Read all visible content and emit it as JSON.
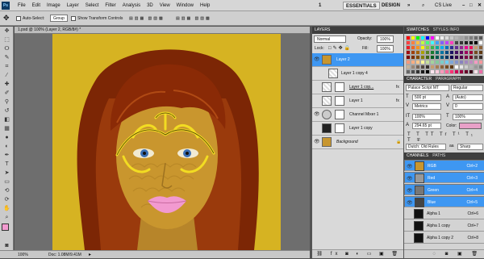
{
  "app": {
    "logo": "Ps",
    "ws_number": "1",
    "ws_essentials": "ESSENTIALS",
    "ws_design": "DESIGN",
    "ws_more": "»",
    "cs_live": "CS Live"
  },
  "menu": [
    "File",
    "Edit",
    "Image",
    "Layer",
    "Select",
    "Filter",
    "Analysis",
    "3D",
    "View",
    "Window",
    "Help"
  ],
  "options": {
    "auto_select": "Auto-Select:",
    "group": "Group",
    "show_transform": "Show Transform Controls"
  },
  "document": {
    "tab": "1.psd @ 100% (Layer 2, RGB/8#) *",
    "zoom": "100%",
    "doc_size": "Doc: 1.08M/9.41M"
  },
  "layers": {
    "tabs": [
      "LAYERS"
    ],
    "blend_mode": "Normal",
    "opacity_label": "Opacity:",
    "opacity": "100%",
    "lock_label": "Lock:",
    "fill_label": "Fill:",
    "fill": "100%",
    "rows": [
      "Layer 2",
      "Layer 1 copy 4",
      "Layer 1 cop...",
      "Layer 1",
      "Channel Mixer 1",
      "Layer 1 copy",
      "Background"
    ]
  },
  "swatches": {
    "tabs": [
      "SWATCHES",
      "STYLES",
      "INFO"
    ],
    "colors": [
      "#ff0000",
      "#ffff00",
      "#00ff00",
      "#00ffff",
      "#0000ff",
      "#ff00ff",
      "#ffffff",
      "#ededed",
      "#dadada",
      "#c8c8c8",
      "#b5b5b5",
      "#a3a3a3",
      "#909090",
      "#7e7e7e",
      "#6b6b6b",
      "#595959",
      "#ff4040",
      "#ff8040",
      "#ffc040",
      "#c0ff40",
      "#40ff80",
      "#40ffff",
      "#40a0ff",
      "#8060ff",
      "#c040ff",
      "#ff40c0",
      "#464646",
      "#343434",
      "#212121",
      "#101010",
      "#000000",
      "#ffffff",
      "#ed1c24",
      "#f26522",
      "#f7941d",
      "#fff200",
      "#8dc63f",
      "#39b54a",
      "#00a99d",
      "#00aeef",
      "#0072bc",
      "#2e3192",
      "#662d91",
      "#92278f",
      "#ec008c",
      "#ed145b",
      "#c69c6d",
      "#8c6239",
      "#9e0b0f",
      "#a0410d",
      "#a36209",
      "#aba000",
      "#598527",
      "#197b30",
      "#007066",
      "#0076a3",
      "#004a80",
      "#1b1464",
      "#440e62",
      "#630460",
      "#9e005d",
      "#9e0039",
      "#754c24",
      "#603913",
      "#790000",
      "#7b2e00",
      "#7d4900",
      "#827b00",
      "#406618",
      "#005e20",
      "#005952",
      "#005b7f",
      "#003663",
      "#0d004c",
      "#32004b",
      "#4b0049",
      "#7b0046",
      "#7a0026",
      "#534741",
      "#362f2d",
      "#f7977a",
      "#f9ad81",
      "#fdc68a",
      "#fff79a",
      "#c4df9b",
      "#a3d39c",
      "#82ca9d",
      "#7bcdc8",
      "#6ecff6",
      "#7ea7d8",
      "#8493ca",
      "#8882be",
      "#a187be",
      "#bc8dbf",
      "#f49ac2",
      "#f6989d",
      "#c7b299",
      "#998675",
      "#736357",
      "#534741",
      "#37302d",
      "#c69c6d",
      "#a67c52",
      "#8c6239",
      "#754c24",
      "#603913",
      "#ffffff",
      "#e6e6e6",
      "#cccccc",
      "#b3b3b3",
      "#999999",
      "#808080",
      "#666666",
      "#4d4d4d",
      "#333333",
      "#1a1a1a",
      "#000000",
      "#ffe6f0",
      "#ffccdd",
      "#ff99bb",
      "#ff6699",
      "#ff3377",
      "#cc0055",
      "#990040",
      "#660029",
      "#330015",
      "#fbe3ea",
      "#ed6da7"
    ]
  },
  "character": {
    "tabs": [
      "CHARACTER",
      "PARAGRAPH"
    ],
    "font": "Palace Script MT",
    "style": "Regular",
    "size": "500 pt",
    "leading": "(Auto)",
    "kerning": "Metrics",
    "tracking": "0",
    "vscale": "100%",
    "hscale": "100%",
    "baseline": "294.65 pt",
    "color_label": "Color:",
    "language": "Dutch: Old Rules",
    "aa_icon": "aa",
    "aa": "Sharp",
    "color": "#e8a0c8"
  },
  "channels": {
    "tabs": [
      "CHANNELS",
      "PATHS"
    ],
    "rows": [
      {
        "name": "RGB",
        "key": "Ctrl+2"
      },
      {
        "name": "Red",
        "key": "Ctrl+3"
      },
      {
        "name": "Green",
        "key": "Ctrl+4"
      },
      {
        "name": "Blue",
        "key": "Ctrl+5"
      },
      {
        "name": "Alpha 1",
        "key": "Ctrl+6"
      },
      {
        "name": "Alpha 1 copy",
        "key": "Ctrl+7"
      },
      {
        "name": "Alpha 1 copy 2",
        "key": "Ctrl+8"
      }
    ]
  },
  "colors": {
    "accent": "#3e97f2",
    "canvas_bg": "#d8b623",
    "hair": "#8a2a06",
    "skin": "#c9962e",
    "lips": "#f29ad0",
    "mask": "#e8c21c"
  }
}
